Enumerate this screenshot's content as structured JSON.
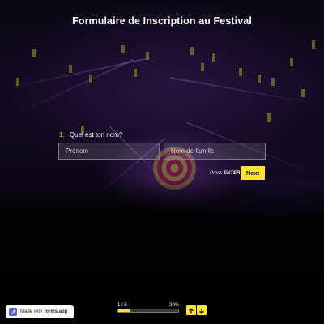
{
  "form": {
    "title": "Formulaire de Inscription au Festival",
    "question_number": "1.",
    "question_text": "Quel est ton nom?",
    "first_name_placeholder": "Prénom",
    "last_name_placeholder": "Nom de famille",
    "first_name_value": "",
    "last_name_value": "",
    "hint_prefix": "Press",
    "hint_key": "ENTER",
    "next_label": "Next"
  },
  "footer": {
    "badge_prefix": "Made with",
    "badge_brand": "forms.app",
    "progress_count": "1 / 5",
    "progress_percent_label": "20%",
    "progress_fraction": 0.2
  },
  "icons": {
    "brand_logo": "forms-app-logo-icon",
    "nav_up": "arrow-up-icon",
    "nav_down": "arrow-down-icon"
  },
  "colors": {
    "accent": "#fde52d",
    "question_number": "#f2d416",
    "badge_logo": "#5a5ce0"
  }
}
